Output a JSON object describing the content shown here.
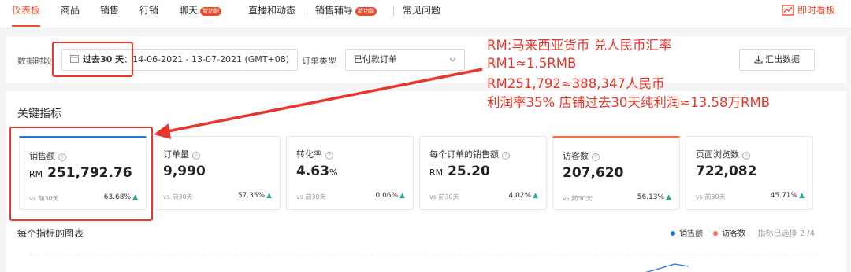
{
  "nav": {
    "items": [
      {
        "label": "仪表板",
        "active": true
      },
      {
        "label": "商品"
      },
      {
        "label": "销售"
      },
      {
        "label": "行销"
      },
      {
        "label": "聊天",
        "badge": "新功能"
      },
      {
        "label": "直播和动态"
      },
      {
        "label": "销售辅导",
        "badge": "新功能"
      },
      {
        "label": "常见问题"
      }
    ],
    "live_board": "即时看板"
  },
  "filters": {
    "period_label": "数据时段",
    "period_prefix": "过去30 天",
    "period_range": "：14-06-2021 - 13-07-2021 (GMT+08)",
    "order_type_label": "订单类型",
    "order_type_value": "已付款订单",
    "export_label": "汇出数据"
  },
  "key_metrics": {
    "title": "关键指标",
    "cards": [
      {
        "title": "销售额",
        "currency": "RM",
        "value": "251,792.76",
        "compare": "vs 前30天",
        "change": "63.68%"
      },
      {
        "title": "订单量",
        "currency": "",
        "value": "9,990",
        "compare": "vs 前30天",
        "change": "57.35%"
      },
      {
        "title": "转化率",
        "currency": "",
        "value": "4.63",
        "unit": "%",
        "compare": "vs 前30天",
        "change": "0.06%"
      },
      {
        "title": "每个订单的销售额",
        "currency": "RM",
        "value": "25.20",
        "compare": "vs 前30天",
        "change": "4.02%"
      },
      {
        "title": "访客数",
        "currency": "",
        "value": "207,620",
        "compare": "vs 前30天",
        "change": "56.13%"
      },
      {
        "title": "页面浏览数",
        "currency": "",
        "value": "722,082",
        "compare": "vs 前30天",
        "change": "45.71%"
      }
    ]
  },
  "chart_section": {
    "title": "每个指标的图表",
    "legend": [
      {
        "name": "销售额",
        "color": "#2673dd"
      },
      {
        "name": "访客数",
        "color": "#ee6e4d"
      }
    ],
    "selected_note": "指标已选择 2 /4"
  },
  "annotation": {
    "lines": [
      "RM:马来西亚货币 兑人民币汇率",
      "RM1≈1.5RMB",
      "RM251,792≈388,347人民币",
      "利润率35% 店铺过去30天纯利润≈13.58万RMB"
    ],
    "color": "#e8362a"
  }
}
